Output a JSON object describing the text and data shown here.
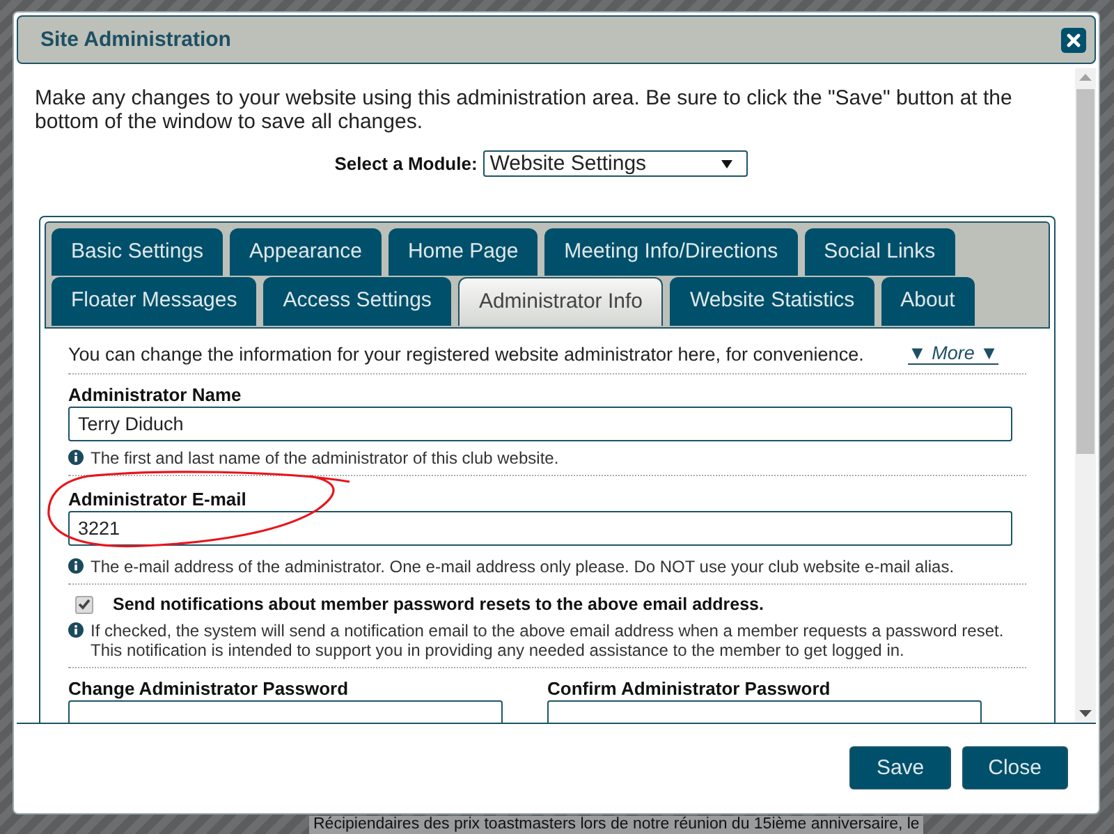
{
  "background_text": "Récipiendaires des prix toastmasters lors de notre réunion du 15ième anniversaire, le",
  "window": {
    "title": "Site Administration"
  },
  "intro": "Make any changes to your website using this administration area. Be sure to click the \"Save\" button at the bottom of the window to save all changes.",
  "module_select": {
    "label": "Select a Module:",
    "value": "Website Settings"
  },
  "tab_rows": [
    [
      {
        "label": "Basic Settings",
        "selected": false
      },
      {
        "label": "Appearance",
        "selected": false
      },
      {
        "label": "Home Page",
        "selected": false
      },
      {
        "label": "Meeting Info/Directions",
        "selected": false
      },
      {
        "label": "Social Links",
        "selected": false
      }
    ],
    [
      {
        "label": "Floater Messages",
        "selected": false
      },
      {
        "label": "Access Settings",
        "selected": false
      },
      {
        "label": "Administrator Info",
        "selected": true
      },
      {
        "label": "Website Statistics",
        "selected": false
      },
      {
        "label": "About",
        "selected": false
      }
    ]
  ],
  "description": "You can change the information for your registered website administrator here, for convenience.",
  "more_link": "▼ More ▼",
  "sections": [
    {
      "kind": "text",
      "label": "Administrator Name",
      "value": "Terry Diduch",
      "help": "The first and last name of the administrator of this club website."
    },
    {
      "kind": "text",
      "label": "Administrator E-mail",
      "value": "3221",
      "help": "The e-mail address of the administrator. One e-mail address only please. Do NOT use your club website e-mail alias.",
      "circled": true
    },
    {
      "kind": "checkbox",
      "label": "Send notifications about member password resets to the above email address.",
      "checked": true,
      "help": "If checked, the system will send a notification email to the above email address when a member requests a password reset. This notification is intended to support you in providing any needed assistance to the member to get logged in."
    },
    {
      "kind": "pair",
      "fields": [
        {
          "label": "Change Administrator Password"
        },
        {
          "label": "Confirm Administrator Password"
        }
      ]
    }
  ],
  "buttons": [
    {
      "label": "Save"
    },
    {
      "label": "Close"
    }
  ]
}
